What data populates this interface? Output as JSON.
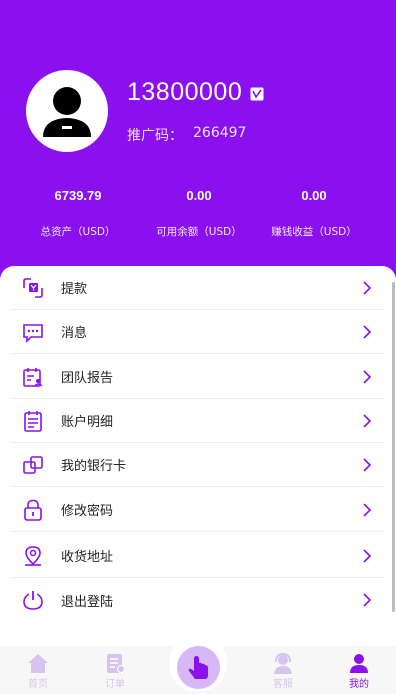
{
  "profile": {
    "phone": "13800000",
    "promo_label": "推广码：",
    "promo_code": "266497"
  },
  "stats": [
    {
      "value": "6739.79",
      "label": "总资产（USD）"
    },
    {
      "value": "0.00",
      "label": "可用余额（USD）"
    },
    {
      "value": "0.00",
      "label": "赚钱收益（USD）"
    }
  ],
  "menu": [
    {
      "label": "提款",
      "icon": "withdraw-icon"
    },
    {
      "label": "消息",
      "icon": "message-icon"
    },
    {
      "label": "团队报告",
      "icon": "team-report-icon"
    },
    {
      "label": "账户明细",
      "icon": "account-details-icon"
    },
    {
      "label": "我的银行卡",
      "icon": "bank-card-icon"
    },
    {
      "label": "修改密码",
      "icon": "lock-icon"
    },
    {
      "label": "收货地址",
      "icon": "location-icon"
    },
    {
      "label": "退出登陆",
      "icon": "power-icon"
    }
  ],
  "tabbar": [
    {
      "label": "首页",
      "icon": "home-icon"
    },
    {
      "label": "订单",
      "icon": "order-icon"
    },
    {
      "label": "客服",
      "icon": "support-icon"
    },
    {
      "label": "我的",
      "icon": "user-icon"
    }
  ],
  "colors": {
    "brand": "#8a10ee",
    "tab_inactive": "#d6c4ef",
    "center_button": "#d6b8f5"
  }
}
